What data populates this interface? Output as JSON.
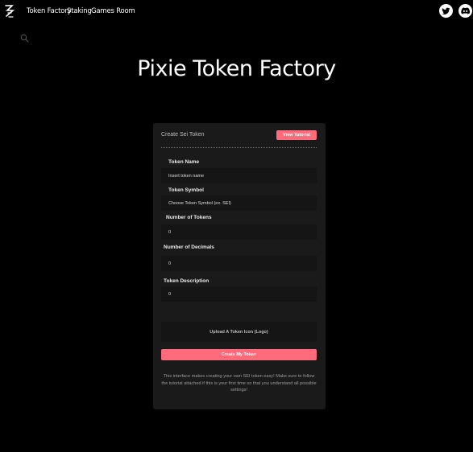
{
  "nav": {
    "links": [
      "Token Factory",
      "Staking",
      "Games Room"
    ],
    "logo_icon": "pixie-logo-icon",
    "social": [
      "twitter-icon",
      "discord-icon"
    ],
    "search_icon": "search-icon"
  },
  "page": {
    "title": "Pixie Token Factory"
  },
  "card": {
    "heading": "Create Sei Token",
    "tutorial_button": "View Tutorial",
    "fields": [
      {
        "label": "Token Name",
        "value": "",
        "placeholder": "Insert token name"
      },
      {
        "label": "Token Symbol",
        "value": "",
        "placeholder": "Choose Token Symbol (ex. SEI)"
      },
      {
        "label": "Number of Tokens",
        "value": "0",
        "placeholder": ""
      },
      {
        "label": "Number of Decimals",
        "value": "0",
        "placeholder": ""
      },
      {
        "label": "Token Description",
        "value": "0",
        "placeholder": ""
      }
    ],
    "upload_label": "Upload A Token Icon (Logo)",
    "create_button": "Create My Token",
    "note": "This interface makes creating your own SEI token easy! Make sure to follow the tutorial attached if this is your first time so that you understand all possible settings!"
  },
  "colors": {
    "accent": "#ff6b7a",
    "background": "#000000",
    "card": "#1a1a1a",
    "field": "#151515"
  }
}
